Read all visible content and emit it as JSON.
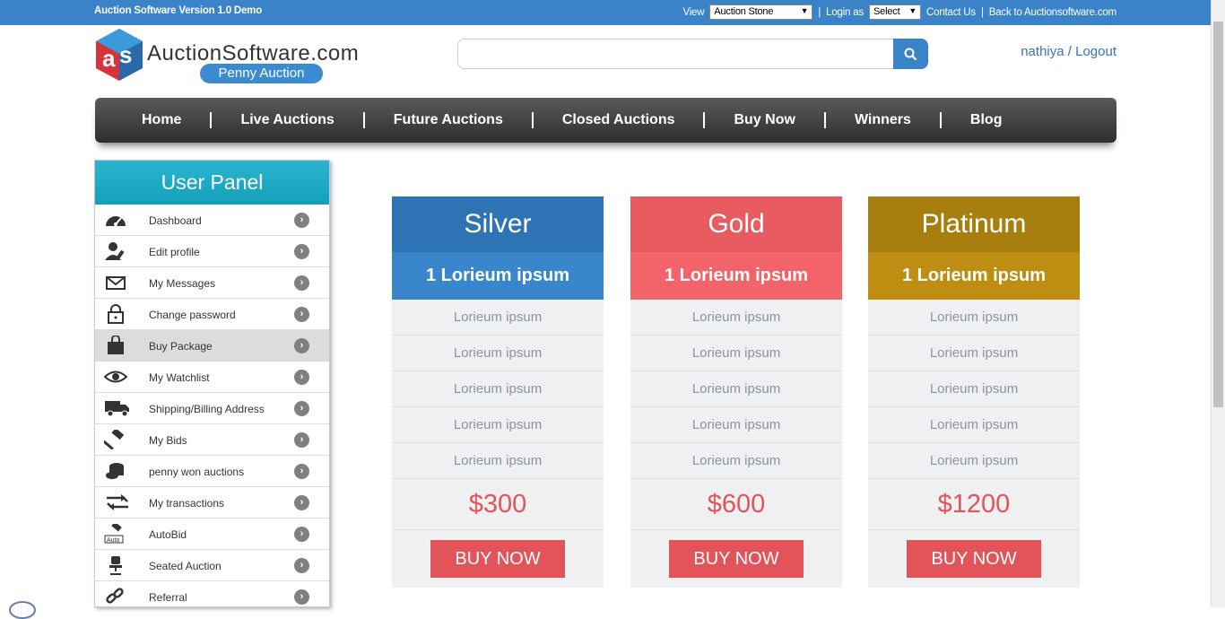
{
  "topbar": {
    "version": "Auction Software Version 1.0 Demo",
    "view_label": "View",
    "view_value": "Auction Stone",
    "login_label": "Login as",
    "login_value": "Select",
    "contact": "Contact Us",
    "back": "Back to Auctionsoftware.com"
  },
  "header": {
    "brand": "AuctionSoftware.com",
    "tagline": "Penny Auction",
    "username": "nathiya",
    "logout": "Logout",
    "user_sep": "/"
  },
  "nav": [
    "Home",
    "Live Auctions",
    "Future Auctions",
    "Closed Auctions",
    "Buy Now",
    "Winners",
    "Blog"
  ],
  "sidebar": {
    "title": "User Panel",
    "items": [
      {
        "label": "Dashboard",
        "icon": "dashboard-icon"
      },
      {
        "label": "Edit profile",
        "icon": "edit-profile-icon"
      },
      {
        "label": "My Messages",
        "icon": "envelope-icon"
      },
      {
        "label": "Change password",
        "icon": "lock-icon"
      },
      {
        "label": "Buy Package",
        "icon": "shopping-bag-icon"
      },
      {
        "label": "My Watchlist",
        "icon": "eye-icon"
      },
      {
        "label": "Shipping/Billing Address",
        "icon": "truck-icon"
      },
      {
        "label": "My Bids",
        "icon": "gavel-icon"
      },
      {
        "label": "penny won auctions",
        "icon": "coins-icon"
      },
      {
        "label": "My transactions",
        "icon": "transfer-icon"
      },
      {
        "label": "AutoBid",
        "icon": "autobid-icon"
      },
      {
        "label": "Seated Auction",
        "icon": "chair-icon"
      },
      {
        "label": "Referral",
        "icon": "link-icon"
      }
    ],
    "active_index": 4
  },
  "packages": [
    {
      "title": "Silver",
      "subtitle": "1 Lorieum ipsum",
      "features": [
        "Lorieum ipsum",
        "Lorieum ipsum",
        "Lorieum ipsum",
        "Lorieum ipsum",
        "Lorieum ipsum"
      ],
      "price": "$300",
      "button": "BUY NOW",
      "title_color": "#2e74b5",
      "subtitle_color": "#3a86cc"
    },
    {
      "title": "Gold",
      "subtitle": "1 Lorieum ipsum",
      "features": [
        "Lorieum ipsum",
        "Lorieum ipsum",
        "Lorieum ipsum",
        "Lorieum ipsum",
        "Lorieum ipsum"
      ],
      "price": "$600",
      "button": "BUY NOW",
      "title_color": "#e85c61",
      "subtitle_color": "#f26469"
    },
    {
      "title": "Platinum",
      "subtitle": "1 Lorieum ipsum",
      "features": [
        "Lorieum ipsum",
        "Lorieum ipsum",
        "Lorieum ipsum",
        "Lorieum ipsum",
        "Lorieum ipsum"
      ],
      "price": "$1200",
      "button": "BUY NOW",
      "title_color": "#a87f0e",
      "subtitle_color": "#bd8e12"
    }
  ],
  "colors": {
    "topbar": "#3a83c8",
    "accent_red": "#e2545a"
  }
}
